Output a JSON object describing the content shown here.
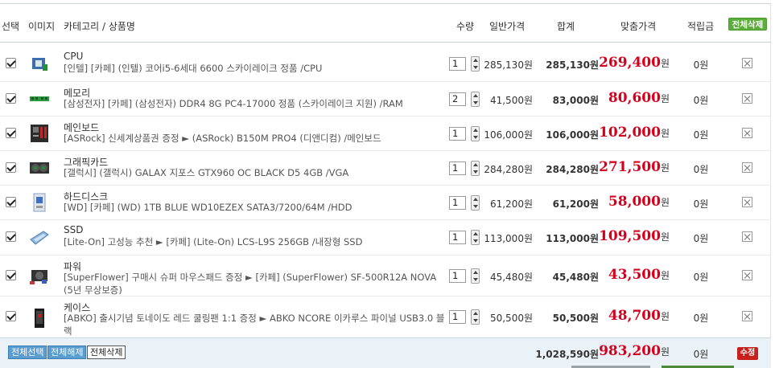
{
  "header": {
    "select": "선택",
    "image": "이미지",
    "category_name": "카테고리 / 상품명",
    "qty": "수량",
    "price": "일반가격",
    "sum": "합계",
    "fit_price": "맞춤가격",
    "points": "적립금",
    "delete_all": "전체삭제"
  },
  "won": "원",
  "items": [
    {
      "category": "CPU",
      "name": "[인텔] [카페] (인텔) 코어i5-6세대 6600 스카이레이크 정품 /CPU",
      "qty": "1",
      "price": "285,130원",
      "sum": "285,130원",
      "fit": "269,400",
      "points": "0원",
      "icon": "cpu-icon"
    },
    {
      "category": "메모리",
      "name": "[삼성전자] [카페] (삼성전자) DDR4 8G PC4-17000 정품 (스카이레이크 지원) /RAM",
      "qty": "2",
      "price": "41,500원",
      "sum": "83,000원",
      "fit": "80,600",
      "points": "0원",
      "icon": "ram-icon"
    },
    {
      "category": "메인보드",
      "name": "[ASRock] 신세계상품권 증정 ► (ASRock) B150M PRO4 (디앤디컴) /메인보드",
      "qty": "1",
      "price": "106,000원",
      "sum": "106,000원",
      "fit": "102,000",
      "points": "0원",
      "icon": "motherboard-icon"
    },
    {
      "category": "그래픽카드",
      "name": "[갤럭시] (갤럭시) GALAX 지포스 GTX960 OC BLACK D5 4GB /VGA",
      "qty": "1",
      "price": "284,280원",
      "sum": "284,280원",
      "fit": "271,500",
      "points": "0원",
      "icon": "gpu-icon"
    },
    {
      "category": "하드디스크",
      "name": "[WD] [카페] (WD) 1TB BLUE WD10EZEX SATA3/7200/64M /HDD",
      "qty": "1",
      "price": "61,200원",
      "sum": "61,200원",
      "fit": "58,000",
      "points": "0원",
      "icon": "hdd-icon"
    },
    {
      "category": "SSD",
      "name": "[Lite-On] 고성능 추천 ► [카페] (Lite-On) LCS-L9S 256GB /내장형 SSD",
      "qty": "1",
      "price": "113,000원",
      "sum": "113,000원",
      "fit": "109,500",
      "points": "0원",
      "icon": "ssd-icon"
    },
    {
      "category": "파워",
      "name": "[SuperFlower] 구매시 슈퍼 마우스패드 증정 ► [카페] (SuperFlower) SF-500R12A NOVA (5년 무상보증)",
      "qty": "1",
      "price": "45,480원",
      "sum": "45,480원",
      "fit": "43,500",
      "points": "0원",
      "icon": "psu-icon"
    },
    {
      "category": "케이스",
      "name": "[ABKO] 출시기념 토네이도 레드 쿨링팬 1:1 증정 ► ABKO NCORE 이카루스 파이널 USB3.0 블랙",
      "qty": "1",
      "price": "50,500원",
      "sum": "50,500원",
      "fit": "48,700",
      "points": "0원",
      "icon": "case-icon"
    }
  ],
  "footer": {
    "select_all": "전체선택",
    "deselect_all": "전체해제",
    "delete_all": "전체삭제",
    "total": "1,028,590원",
    "fit_total": "983,200",
    "points": "0원",
    "edit": "수정"
  }
}
